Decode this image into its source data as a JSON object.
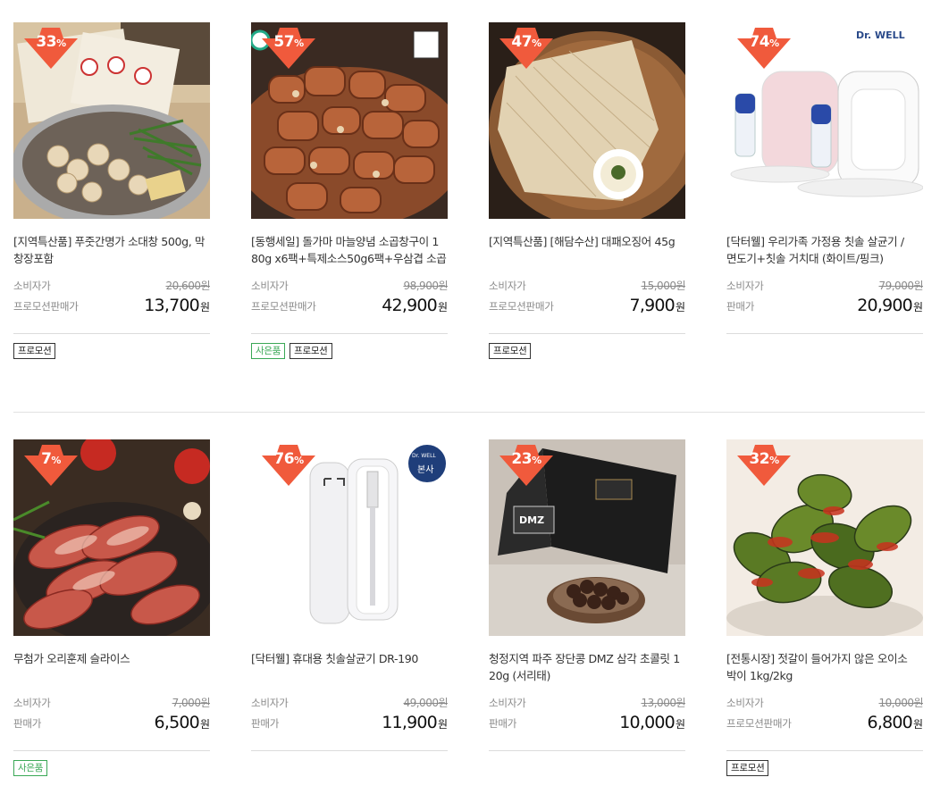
{
  "colors": {
    "badge": "#f05a3c",
    "gift_tag": "#3aa856",
    "promo_tag": "#333333"
  },
  "products": [
    {
      "discount": "33",
      "pct_unit": "%",
      "title": "[지역특산품] 푸줏간명가 소대창 500g, 막\n창장포함",
      "label_orig": "소비자가",
      "orig_price": "20,600원",
      "label_price": "프로모션판매가",
      "price": "13,700",
      "price_unit": "원",
      "tags": [
        "프로모션"
      ]
    },
    {
      "discount": "57",
      "pct_unit": "%",
      "title": "[동행세일] 돌가마 마늘양념 소곱창구이 1\n80g x6팩+특제소스50g6팩+우삼겹 소곱",
      "label_orig": "소비자가",
      "orig_price": "98,900원",
      "label_price": "프로모션판매가",
      "price": "42,900",
      "price_unit": "원",
      "tags": [
        "사은품",
        "프로모션"
      ]
    },
    {
      "discount": "47",
      "pct_unit": "%",
      "title": "[지역특산품] [해담수산] 대패오징어 45g",
      "label_orig": "소비자가",
      "orig_price": "15,000원",
      "label_price": "프로모션판매가",
      "price": "7,900",
      "price_unit": "원",
      "tags": [
        "프로모션"
      ]
    },
    {
      "discount": "74",
      "pct_unit": "%",
      "title": "[닥터웰] 우리가족 가정용 칫솔 살균기 /\n면도기+칫솔 거치대 (화이트/핑크)",
      "label_orig": "소비자가",
      "orig_price": "79,000원",
      "label_price": "판매가",
      "price": "20,900",
      "price_unit": "원",
      "tags": [],
      "brand_text": "Dr. WELL"
    },
    {
      "discount": "7",
      "pct_unit": "%",
      "title": "무첨가 오리훈제 슬라이스",
      "label_orig": "소비자가",
      "orig_price": "7,000원",
      "label_price": "판매가",
      "price": "6,500",
      "price_unit": "원",
      "tags": [
        "사은품"
      ]
    },
    {
      "discount": "76",
      "pct_unit": "%",
      "title": "[닥터웰] 휴대용 칫솔살균기 DR-190",
      "label_orig": "소비자가",
      "orig_price": "49,000원",
      "label_price": "판매가",
      "price": "11,900",
      "price_unit": "원",
      "tags": [],
      "brand_text": "Dr. WELL",
      "brand_sub": "본사"
    },
    {
      "discount": "23",
      "pct_unit": "%",
      "title": "청정지역 파주 장단콩 DMZ 삼각 초콜릿 1\n20g (서리태)",
      "label_orig": "소비자가",
      "orig_price": "13,000원",
      "label_price": "판매가",
      "price": "10,000",
      "price_unit": "원",
      "tags": [],
      "box_text": "DMZ"
    },
    {
      "discount": "32",
      "pct_unit": "%",
      "title": "[전통시장] 젓갈이 들어가지 않은 오이소\n박이 1kg/2kg",
      "label_orig": "소비자가",
      "orig_price": "10,000원",
      "label_price": "프로모션판매가",
      "price": "6,800",
      "price_unit": "원",
      "tags": [
        "프로모션"
      ]
    }
  ]
}
